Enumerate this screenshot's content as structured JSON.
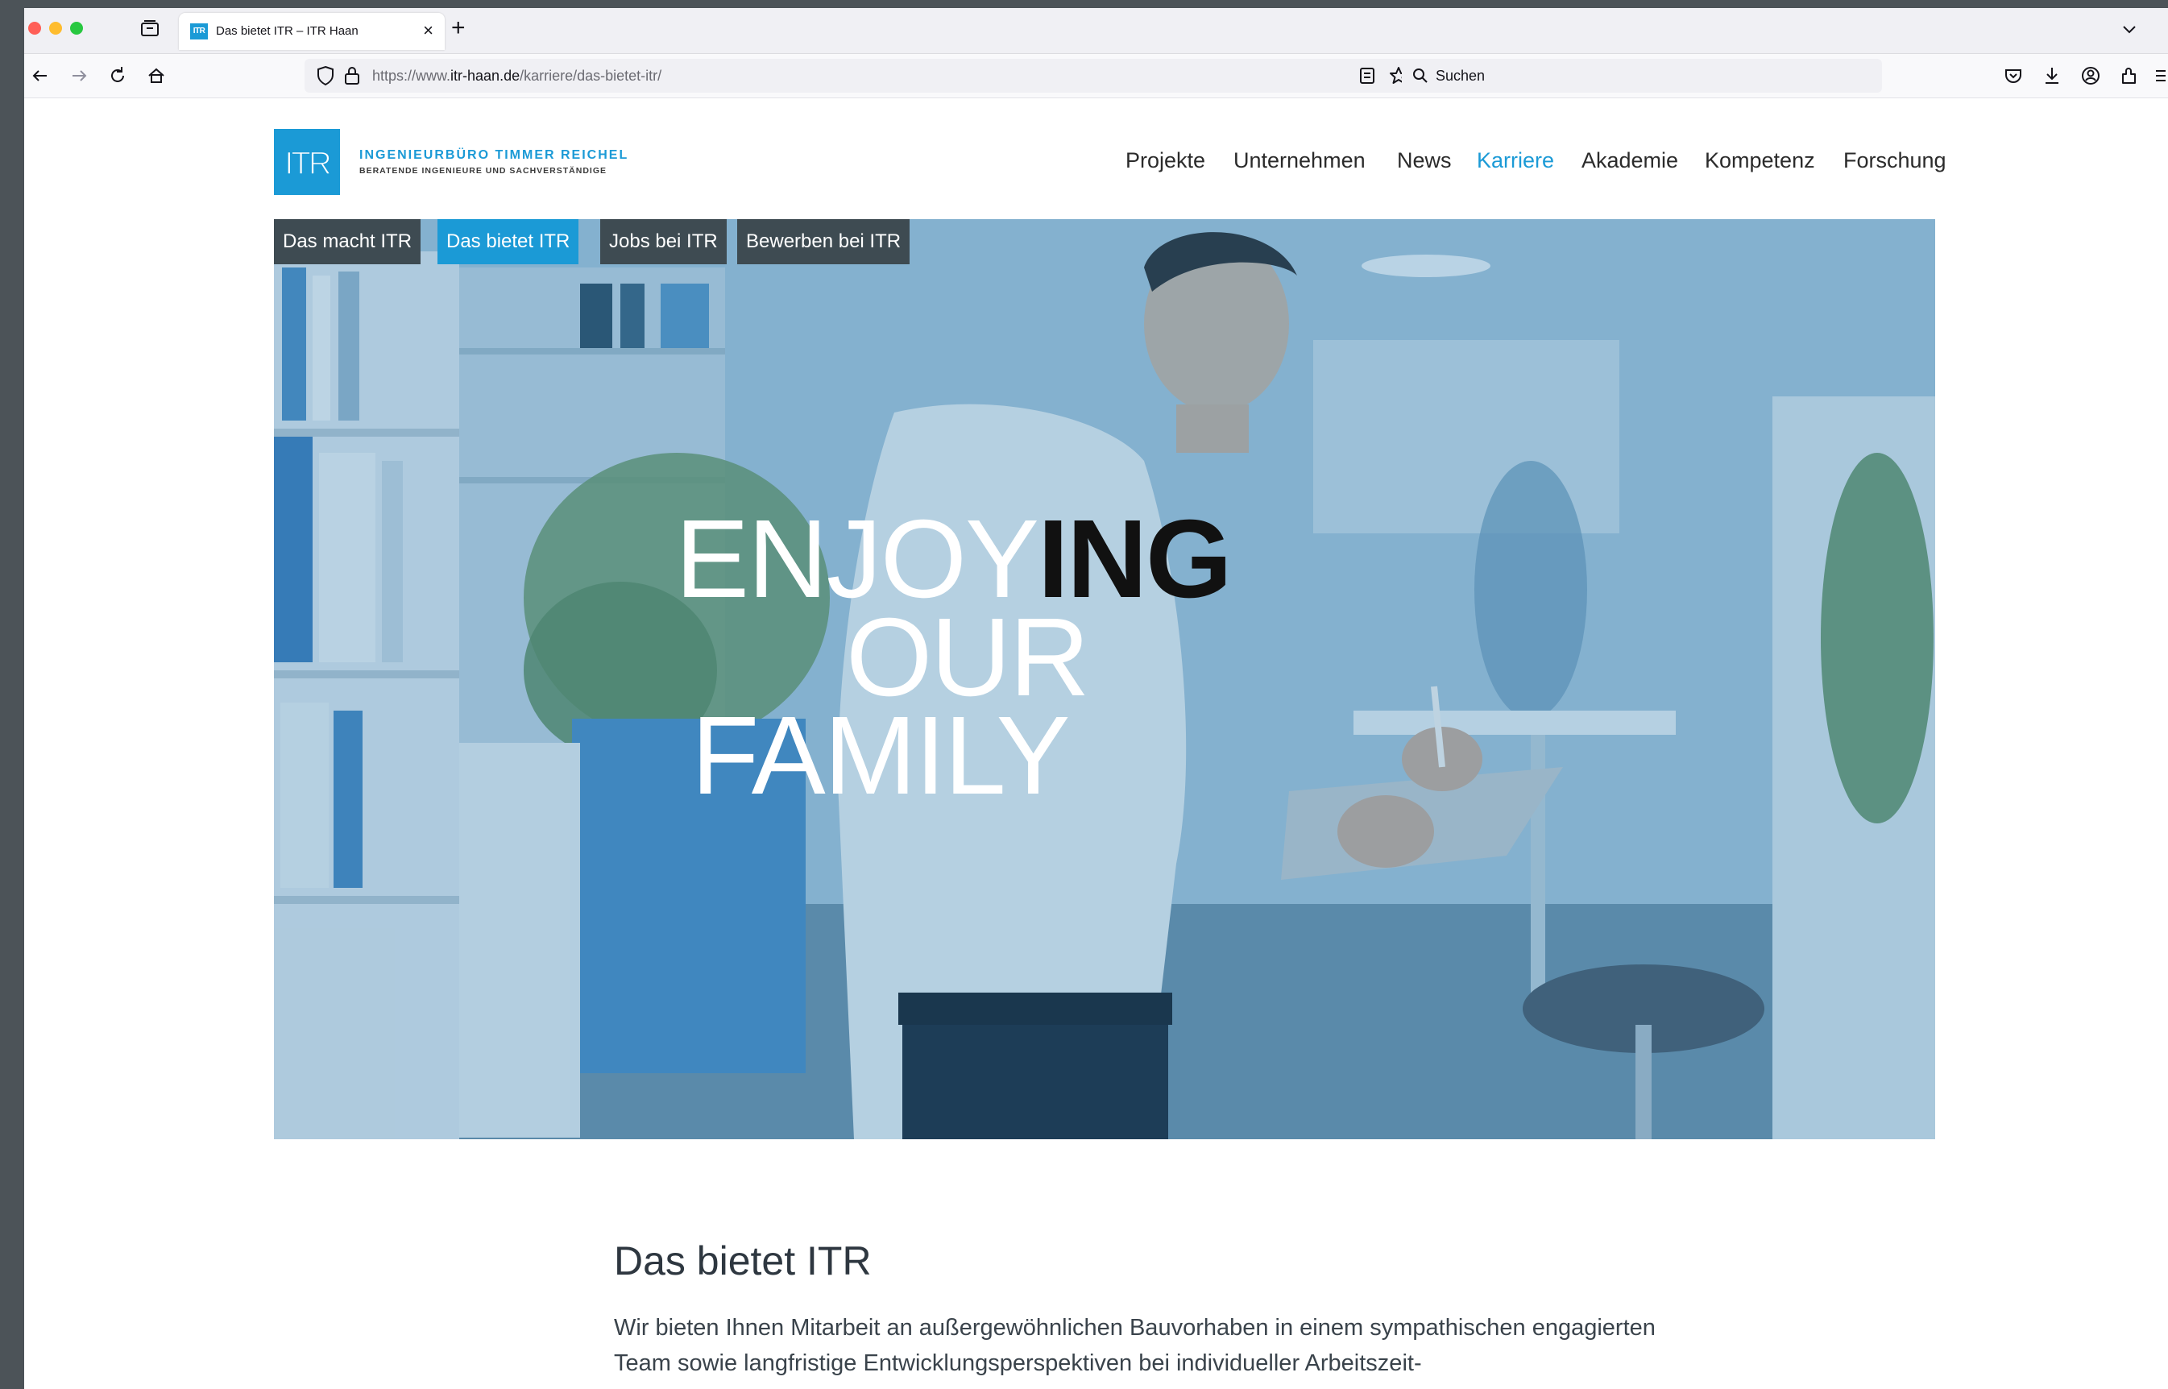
{
  "browser": {
    "tab": {
      "title": "Das bietet ITR – ITR Haan",
      "favicon_text": "ITR",
      "close_glyph": "×"
    },
    "new_tab_glyph": "+",
    "url": {
      "prefix": "https://www.",
      "domain": "itr-haan.de",
      "path": "/karriere/das-bietet-itr/"
    },
    "search": {
      "placeholder": "Suchen"
    }
  },
  "site": {
    "logo_text": "ITR",
    "company_name": "INGENIEURBÜRO TIMMER REICHEL",
    "company_tagline": "BERATENDE INGENIEURE UND SACHVERSTÄNDIGE",
    "nav": [
      {
        "label": "Projekte",
        "active": false
      },
      {
        "label": "Unternehmen",
        "active": false
      },
      {
        "label": "News",
        "active": false
      },
      {
        "label": "Karriere",
        "active": true
      },
      {
        "label": "Akademie",
        "active": false
      },
      {
        "label": "Kompetenz",
        "active": false
      },
      {
        "label": "Forschung",
        "active": false
      }
    ],
    "accent_color": "#1b9ad6"
  },
  "hero": {
    "subtabs": [
      {
        "label": "Das macht ITR",
        "active": false
      },
      {
        "label": "Das bietet ITR",
        "active": true
      },
      {
        "label": "Jobs bei ITR",
        "active": false
      },
      {
        "label": "Bewerben bei ITR",
        "active": false
      }
    ],
    "headline": {
      "line1_light": "ENJOY",
      "line1_bold": "ING",
      "line2": "OUR",
      "line3": "FAMILY"
    }
  },
  "content": {
    "title": "Das bietet ITR",
    "body": "Wir bieten Ihnen Mitarbeit an außergewöhnlichen Bauvorhaben in einem sympathischen engagierten Team sowie langfristige Entwicklungsperspektiven bei individueller Arbeitszeit-"
  }
}
